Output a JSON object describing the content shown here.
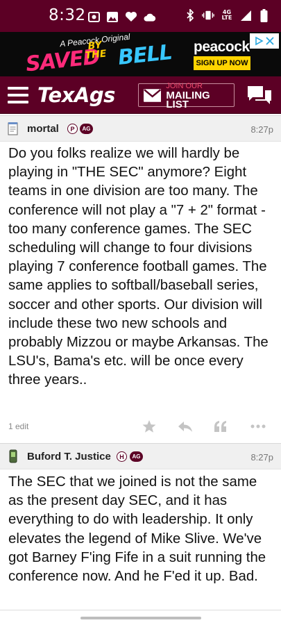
{
  "status_bar": {
    "time": "8:32",
    "network": "4G",
    "network_sub": "LTE"
  },
  "ad": {
    "subline": "A Peacock Original",
    "title_part1": "SAVED",
    "title_part2a": "BY",
    "title_part2b": "THE",
    "title_part3": "BELL",
    "brand": "peacock",
    "cta": "SIGN UP NOW"
  },
  "nav": {
    "logo": "TexAgs",
    "mailing_small": "JOIN OUR",
    "mailing_big": "MAILING LIST"
  },
  "posts": [
    {
      "author": "mortal",
      "badges": [
        "P",
        "AG"
      ],
      "time": "8:27p",
      "body": "Do you folks realize we will hardly be playing in \"THE SEC\" anymore? Eight teams in one division are too many. The conference will not play a \"7 + 2\" format - too many conference games. The SEC scheduling will change to four divisions playing 7 conference football games. The same applies to softball/baseball series, soccer and other sports. Our division will include these two new schools and probably Mizzou or maybe Arkansas. The LSU's, Bama's etc. will be once every three years..",
      "edit_count": "1 edit"
    },
    {
      "author": "Buford T. Justice",
      "badges": [
        "H",
        "AG"
      ],
      "time": "8:27p",
      "body": "The SEC that we joined is not the same as the present day SEC, and it has everything to do with leadership. It only elevates the legend of Mike Slive. We've got Barney F'ing Fife in a suit running the conference now. And he F'ed it up. Bad."
    }
  ],
  "colors": {
    "maroon": "#5c0025",
    "action_gray": "#c4c4c4"
  },
  "icons": {
    "status": [
      "photo-icon",
      "gallery-icon",
      "heart-icon",
      "cloud-icon",
      "bluetooth-icon",
      "vibrate-icon",
      "signal-icon",
      "battery-icon"
    ],
    "nav": [
      "menu-icon",
      "mail-icon",
      "chat-icon"
    ],
    "actions": [
      "star-icon",
      "reply-icon",
      "quote-icon",
      "more-icon"
    ]
  }
}
